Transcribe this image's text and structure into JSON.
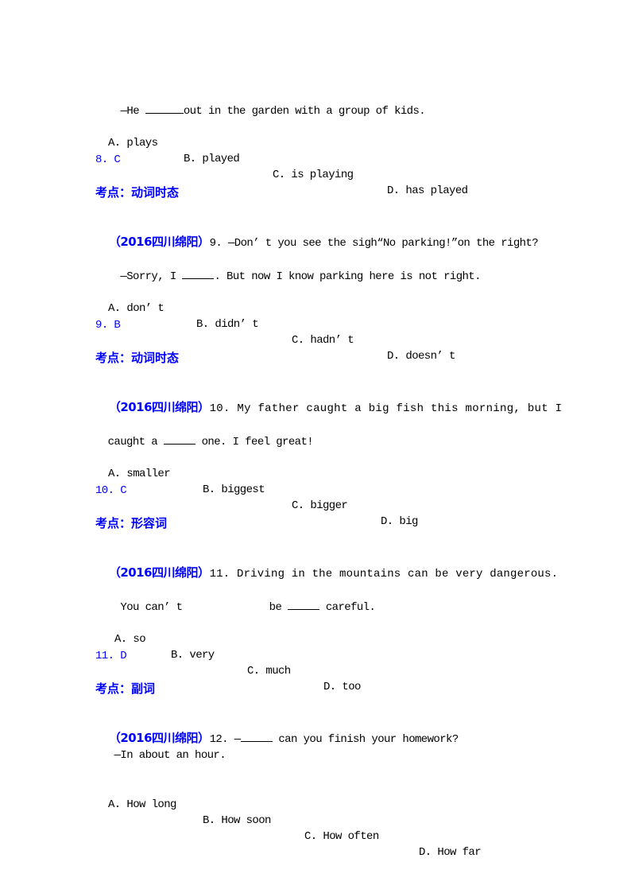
{
  "colors": {
    "text": "#000000",
    "accent_blue": "#0000ff"
  },
  "items": {
    "q8_tail": {
      "dialog_line": {
        "prefix": "—He ",
        "suffix": "out in the garden with a group of kids."
      },
      "options": [
        "A. plays",
        "B. played",
        "C. is playing",
        "D. has played"
      ],
      "answer": "8. C",
      "topic": "考点：动词时态"
    },
    "q9": {
      "source": "（2016四川绵阳）",
      "stem": "9. —Don’ t you see the sigh“No parking!”on the right?",
      "reply": {
        "prefix": " —Sorry, I ",
        "suffix": ". But now I know parking here is not right."
      },
      "options": [
        "A. don’ t",
        "B. didn’ t",
        "C. hadn’ t",
        "D. doesn’ t"
      ],
      "answer": "9. B",
      "topic": "考点：动词时态"
    },
    "q10": {
      "source": "（2016四川绵阳）",
      "stem": "10. My father caught a big fish this morning, but I",
      "stem2": {
        "prefix": "caught a ",
        "suffix": " one. I feel great!"
      },
      "options": [
        "A. smaller",
        "B. biggest",
        "C. bigger",
        "D. big"
      ],
      "answer": "10. C",
      "topic": "考点：形容词"
    },
    "q11": {
      "source": "（2016四川绵阳）",
      "stem": "11. Driving in the mountains can be very dangerous.",
      "stem2": {
        "prefix": " You can’ t              be ",
        "suffix": " careful."
      },
      "options": [
        "A. so",
        "B. very",
        "C. much",
        "D. too"
      ],
      "answer": "11. D",
      "topic": "考点：副词"
    },
    "q12": {
      "source": "（2016四川绵阳）",
      "stem": {
        "prefix": "12. —",
        "suffix": " can you finish your homework?"
      },
      "reply": "  —In about an hour.",
      "options": [
        "A. How long",
        "B. How soon",
        "C. How often",
        "D. How far"
      ]
    }
  }
}
